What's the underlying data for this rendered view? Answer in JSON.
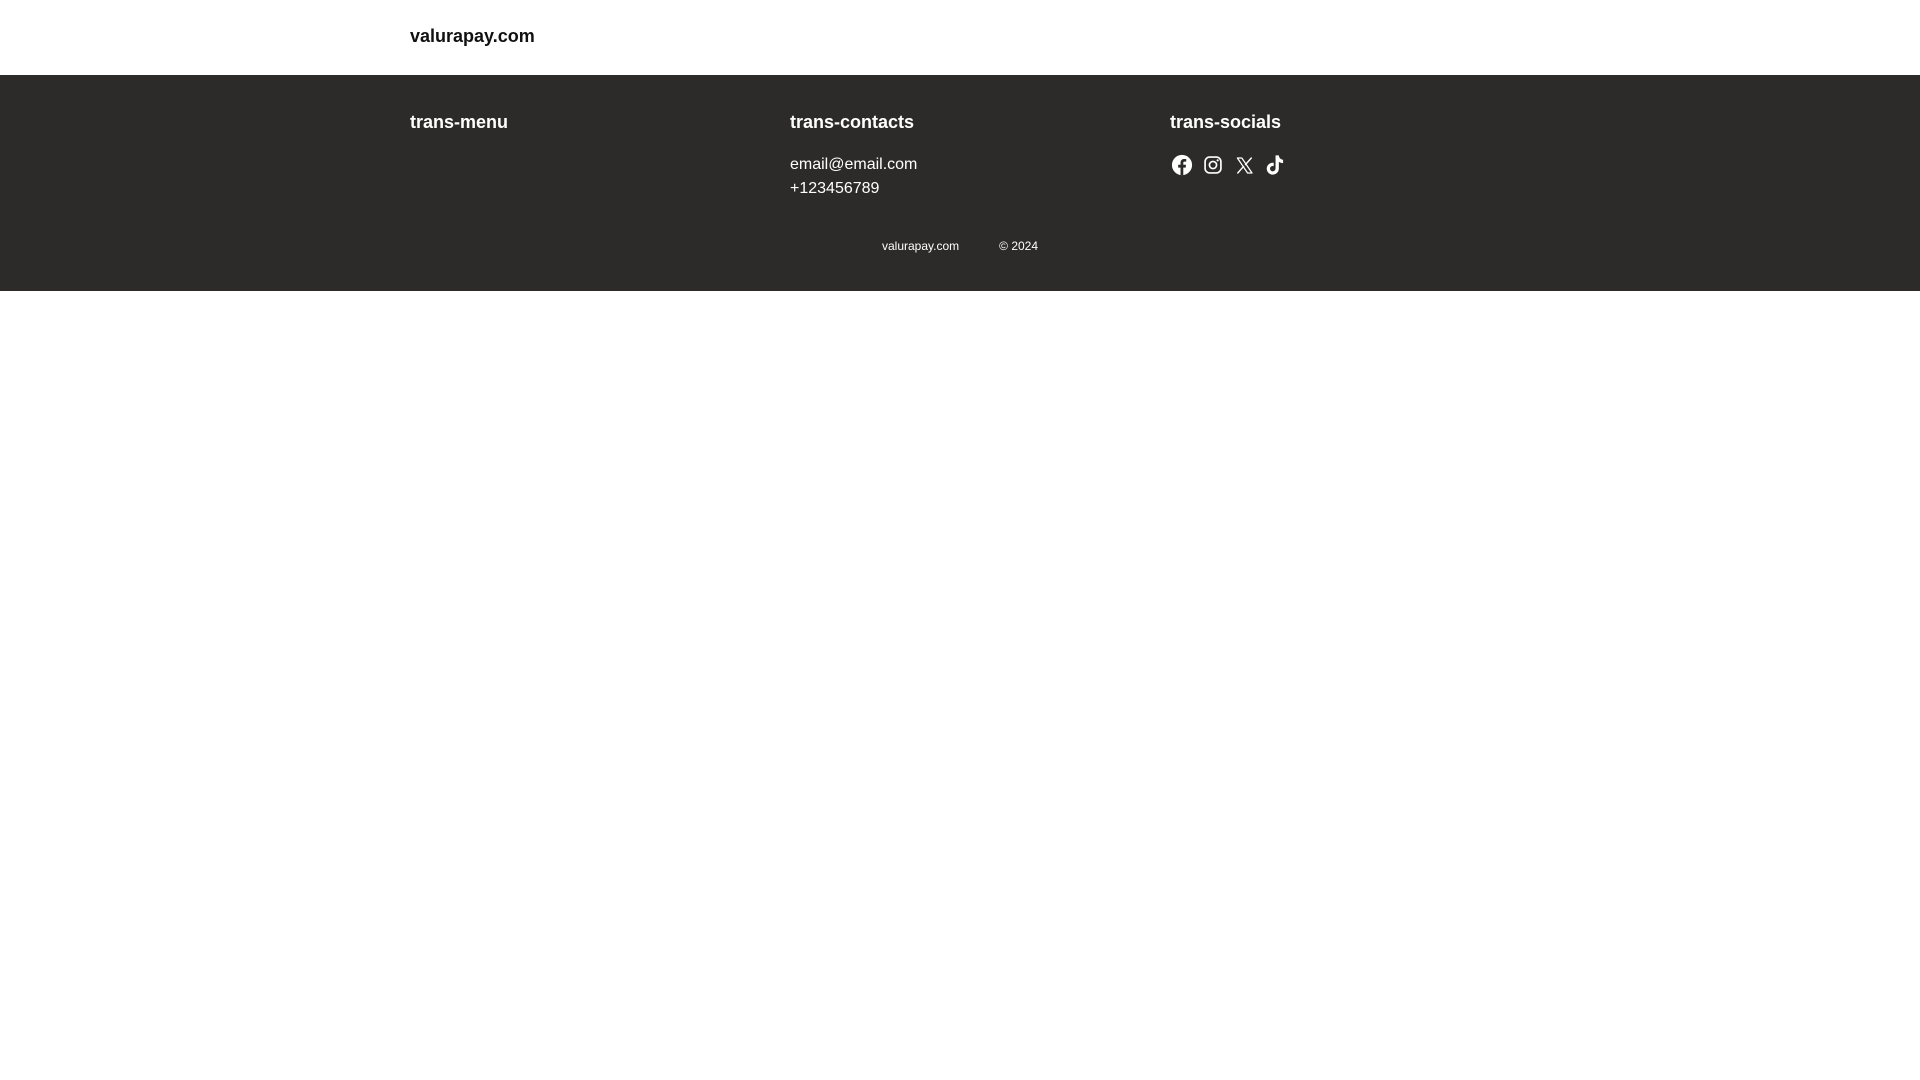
{
  "header": {
    "brand": "valurapay.com"
  },
  "footer": {
    "menu": {
      "title": "trans-menu"
    },
    "contacts": {
      "title": "trans-contacts",
      "email": "email@email.com",
      "phone": "+123456789"
    },
    "socials": {
      "title": "trans-socials",
      "icons": [
        "facebook-icon",
        "instagram-icon",
        "x-icon",
        "tiktok-icon"
      ]
    },
    "bottom": {
      "site": "valurapay.com",
      "copyright": "© 2024"
    }
  },
  "colors": {
    "footer_bg": "#2c2b2a",
    "footer_text": "#ffffff",
    "header_bg": "#ffffff",
    "brand_text": "#111111"
  }
}
